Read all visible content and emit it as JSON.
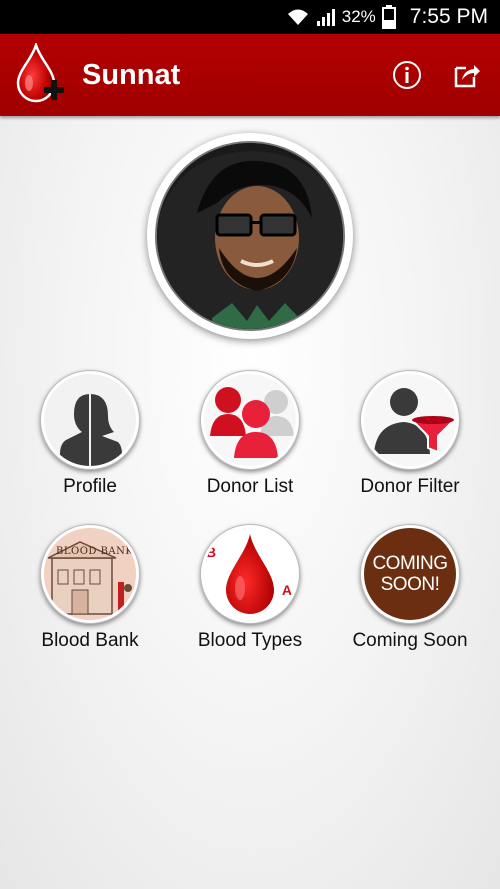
{
  "status_bar": {
    "battery": "32%",
    "time": "7:55 PM"
  },
  "app_bar": {
    "title": "Sunnat",
    "brand_color": "#a80000"
  },
  "menu": [
    {
      "label": "Profile",
      "icon": "profile-silhouette-icon"
    },
    {
      "label": "Donor List",
      "icon": "donor-list-icon"
    },
    {
      "label": "Donor Filter",
      "icon": "donor-filter-icon"
    },
    {
      "label": "Blood Bank",
      "icon": "blood-bank-icon"
    },
    {
      "label": "Blood Types",
      "icon": "blood-types-icon"
    },
    {
      "label": "Coming Soon",
      "icon": "coming-soon-icon"
    }
  ],
  "coming_soon_badge": {
    "line1": "COMING",
    "line2": "SOON!"
  },
  "blood_bank_sign": "BLOOD BANK",
  "blood_types_letters": {
    "left": "B",
    "right": "A"
  }
}
